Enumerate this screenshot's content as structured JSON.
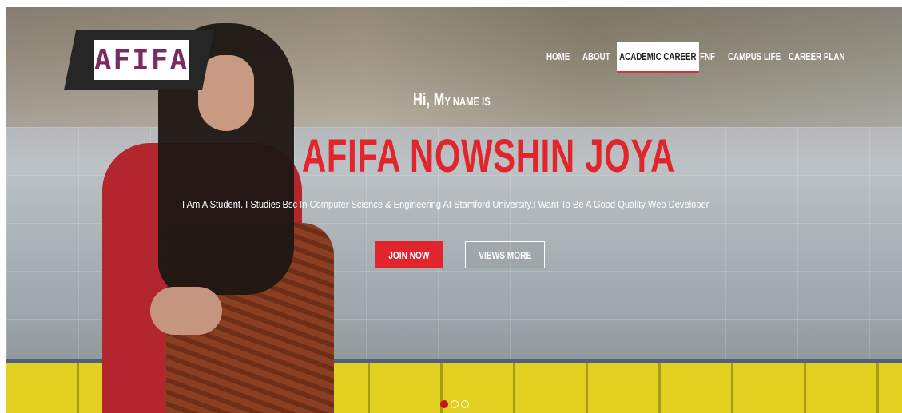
{
  "logo": {
    "text": "AFIFA"
  },
  "nav": {
    "items": [
      {
        "label": "HOME"
      },
      {
        "label": "ABOUT"
      },
      {
        "label": "ACADEMIC CAREER",
        "active": true
      },
      {
        "label": "FNF"
      },
      {
        "label": "CAMPUS LIFE"
      },
      {
        "label": "CAREER PLAN"
      }
    ]
  },
  "hero": {
    "greeting_big": "Hi, M",
    "greeting_rest": "y name is",
    "name": "AFIFA NOWSHIN JOYA",
    "description": "I Am A Student. I Studies Bsc In Computer Science & Engineering At Stamford University.I Want To Be A Good Quality Web Developer",
    "join_label": "JOIN NOW",
    "more_label": "VIEWS MORE"
  },
  "slider": {
    "count": 3,
    "active_index": 0
  },
  "colors": {
    "accent": "#e0262c",
    "logo_text": "#7b2a63",
    "logo_bg": "#262626"
  }
}
